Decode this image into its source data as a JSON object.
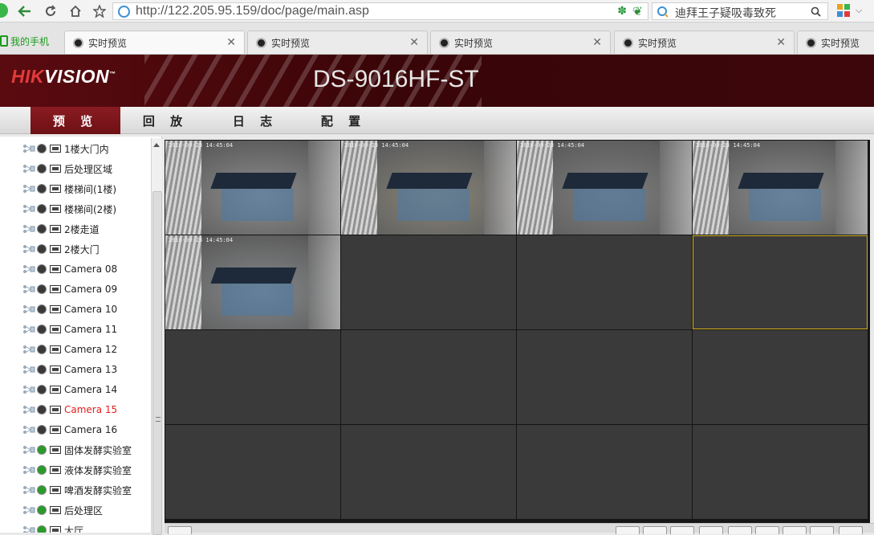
{
  "browser": {
    "url": "http://122.205.95.159/doc/page/main.asp",
    "search_text": "迪拜王子疑吸毒致死",
    "mobile_tab_label": "我的手机",
    "tabs": [
      {
        "label": "实时预览",
        "active": true
      },
      {
        "label": "实时预览",
        "active": false
      },
      {
        "label": "实时预览",
        "active": false
      },
      {
        "label": "实时预览",
        "active": false
      },
      {
        "label": "实时预览",
        "active": false
      }
    ]
  },
  "header": {
    "logo_part1": "HIK",
    "logo_part2": "VISION",
    "model": "DS-9016HF-ST"
  },
  "nav": {
    "items": [
      "预 览",
      "回 放",
      "日 志",
      "配 置"
    ],
    "active_index": 0
  },
  "sidebar": {
    "cameras": [
      {
        "label": "1楼大门内",
        "state": "idle"
      },
      {
        "label": "后处理区域",
        "state": "idle"
      },
      {
        "label": "楼梯间(1楼)",
        "state": "idle"
      },
      {
        "label": "楼梯间(2楼)",
        "state": "idle"
      },
      {
        "label": "2楼走道",
        "state": "idle"
      },
      {
        "label": "2楼大门",
        "state": "idle"
      },
      {
        "label": "Camera 08",
        "state": "idle"
      },
      {
        "label": "Camera 09",
        "state": "idle"
      },
      {
        "label": "Camera 10",
        "state": "idle"
      },
      {
        "label": "Camera 11",
        "state": "idle"
      },
      {
        "label": "Camera 12",
        "state": "idle"
      },
      {
        "label": "Camera 13",
        "state": "idle"
      },
      {
        "label": "Camera 14",
        "state": "idle"
      },
      {
        "label": "Camera 15",
        "state": "idle",
        "highlight": true
      },
      {
        "label": "Camera 16",
        "state": "idle"
      },
      {
        "label": "固体发酵实验室",
        "state": "playing"
      },
      {
        "label": "液体发酵实验室",
        "state": "playing"
      },
      {
        "label": "啤酒发酵实验室",
        "state": "playing"
      },
      {
        "label": "后处理区",
        "state": "playing"
      },
      {
        "label": "大厅",
        "state": "playing"
      }
    ]
  },
  "grid": {
    "rows": 4,
    "cols": 4,
    "live_cells": 5,
    "selected_cell": 7,
    "timestamp": "2016-09-23 14:45:04"
  },
  "colors": {
    "header_dark": "#3a0508",
    "nav_active": "#7a161b",
    "selected_border": "#d8b21c",
    "highlight_text": "#e41d1d"
  }
}
